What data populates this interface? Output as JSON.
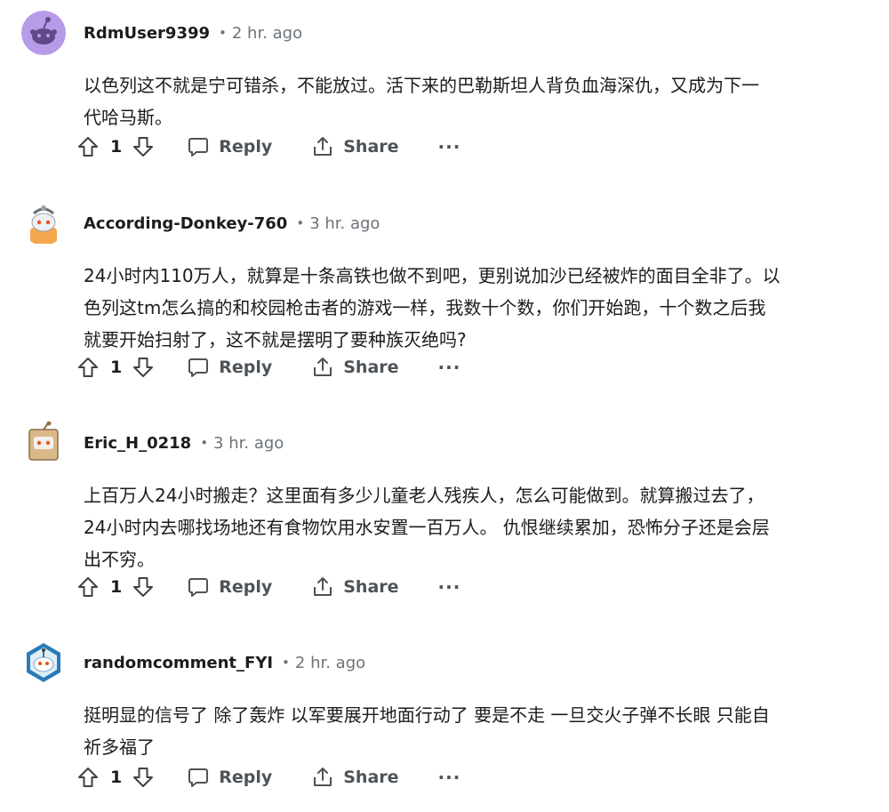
{
  "icons": {
    "upvote": "upvote-arrow-icon",
    "downvote": "downvote-arrow-icon",
    "reply": "speech-bubble-icon",
    "share": "share-upload-icon",
    "more": "more-dots-icon"
  },
  "colors": {
    "username": "#1c1c1c",
    "timestamp": "#6c7378",
    "action_text": "#4d5358",
    "avatar_purple": "#b79be8"
  },
  "comments": [
    {
      "username": "RdmUser9399",
      "separator": "•",
      "time": "2 hr. ago",
      "body": "以色列这不就是宁可错杀，不能放过。活下来的巴勒斯坦人背负血海深仇，又成为下一\n代哈马斯。",
      "score": "1",
      "reply_label": "Reply",
      "share_label": "Share",
      "more_label": "···"
    },
    {
      "username": "According-Donkey-760",
      "separator": "•",
      "time": "3 hr. ago",
      "body": "24小时内110万人，就算是十条高铁也做不到吧，更别说加沙已经被炸的面目全非了。以\n色列这tm怎么搞的和校园枪击者的游戏一样，我数十个数，你们开始跑，十个数之后我\n就要开始扫射了，这不就是摆明了要种族灭绝吗?",
      "score": "1",
      "reply_label": "Reply",
      "share_label": "Share",
      "more_label": "···"
    },
    {
      "username": "Eric_H_0218",
      "separator": "•",
      "time": "3 hr. ago",
      "body": "上百万人24小时搬走？这里面有多少儿童老人残疾人，怎么可能做到。就算搬过去了，\n24小时内去哪找场地还有食物饮用水安置一百万人。 仇恨继续累加，恐怖分子还是会层\n出不穷。",
      "score": "1",
      "reply_label": "Reply",
      "share_label": "Share",
      "more_label": "···"
    },
    {
      "username": "randomcomment_FYI",
      "separator": "•",
      "time": "2 hr. ago",
      "body": "挺明显的信号了 除了轰炸 以军要展开地面行动了 要是不走 一旦交火子弹不长眼 只能自\n祈多福了",
      "score": "1",
      "reply_label": "Reply",
      "share_label": "Share",
      "more_label": "···"
    }
  ]
}
